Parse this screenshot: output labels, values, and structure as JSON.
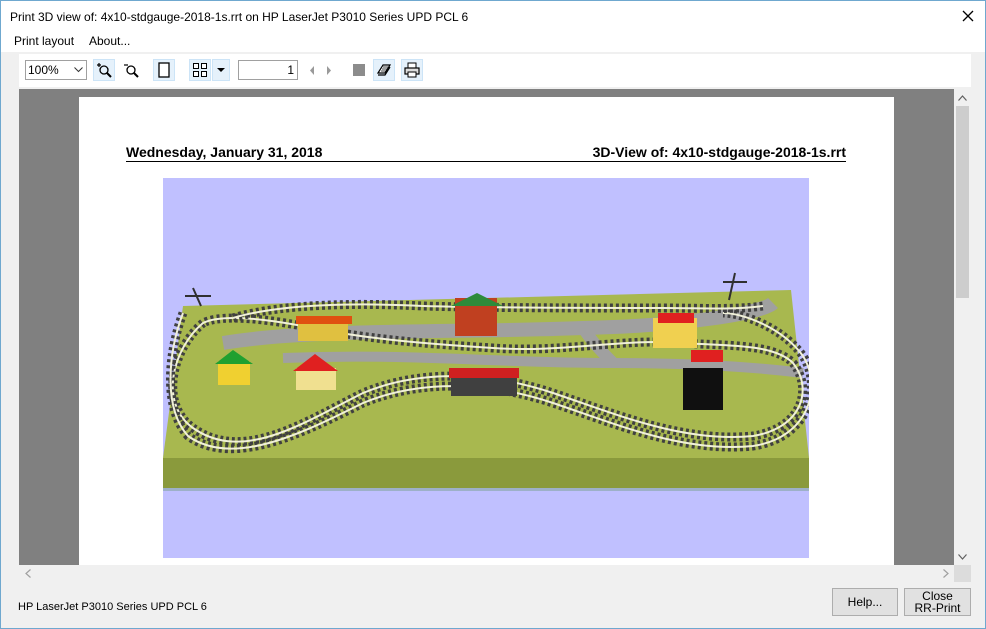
{
  "window": {
    "title": "Print 3D view of: 4x10-stdgauge-2018-1s.rrt on HP LaserJet P3010 Series UPD PCL 6"
  },
  "menu": {
    "items": [
      "Print layout",
      "About..."
    ]
  },
  "toolbar": {
    "zoom_value": "100%",
    "page_number": "1"
  },
  "page": {
    "date": "Wednesday, January 31, 2018",
    "heading": "3D-View of: 4x10-stdgauge-2018-1s.rrt"
  },
  "status": {
    "printer": "HP LaserJet P3010 Series UPD PCL 6"
  },
  "buttons": {
    "help": "Help...",
    "close_line1": "Close",
    "close_line2": "RR-Print"
  },
  "colors": {
    "accent": "#6fa8cf",
    "sky": "#c0c0ff",
    "board": "#a8b84f",
    "board_edge": "#8a9a3c",
    "road": "#a0a0a0",
    "track_ties": "#404040",
    "rail": "#f0f0d8"
  },
  "icons": [
    "close-icon",
    "zoom-in-icon",
    "zoom-out-icon",
    "single-page-icon",
    "multi-page-icon",
    "chevron-down-icon",
    "prev-page-icon",
    "next-page-icon",
    "stop-icon",
    "print-setup-icon",
    "print-icon"
  ]
}
